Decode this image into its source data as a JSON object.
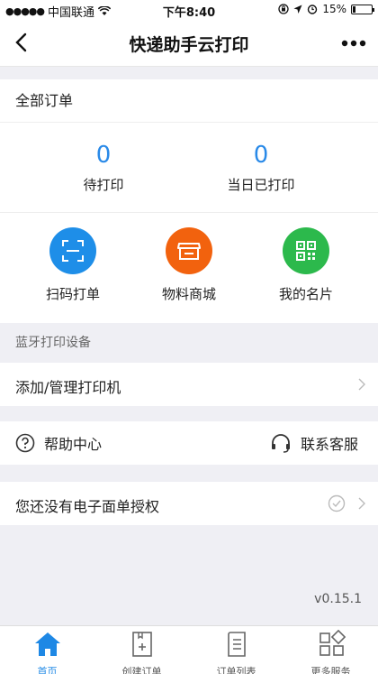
{
  "status_bar": {
    "carrier": "中国联通",
    "time": "下午8:40",
    "battery_percent": "15%",
    "battery_level": 0.15,
    "icons": [
      "signal-dots-icon",
      "wifi-icon",
      "screen-lock-icon",
      "location-icon",
      "alarm-icon",
      "battery-icon"
    ]
  },
  "nav": {
    "title": "快递助手云打印",
    "back_icon": "chevron-left-icon",
    "more_icon": "more-dots-icon"
  },
  "orders": {
    "heading": "全部订单",
    "stats": [
      {
        "value": "0",
        "label": "待打印"
      },
      {
        "value": "0",
        "label": "当日已打印"
      }
    ],
    "actions": [
      {
        "label": "扫码打单",
        "icon": "scan-icon",
        "color": "#1e8ee8"
      },
      {
        "label": "物料商城",
        "icon": "shop-icon",
        "color": "#f2620e"
      },
      {
        "label": "我的名片",
        "icon": "qr-code-icon",
        "color": "#2cb94c"
      }
    ]
  },
  "bluetooth": {
    "section_label": "蓝牙打印设备",
    "manage_printer": "添加/管理打印机"
  },
  "support": {
    "help_center": "帮助中心",
    "contact_service": "联系客服"
  },
  "waybill": {
    "label": "您还没有电子面单授权"
  },
  "version": "v0.15.1",
  "tabs": [
    {
      "label": "首页",
      "icon": "home-icon",
      "active": true
    },
    {
      "label": "创建订单",
      "icon": "create-order-icon",
      "active": false
    },
    {
      "label": "订单列表",
      "icon": "order-list-icon",
      "active": false
    },
    {
      "label": "更多服务",
      "icon": "more-services-icon",
      "active": false
    }
  ],
  "colors": {
    "accent_blue": "#2a8ae8",
    "tab_active": "#1e88e5",
    "background": "#efeff4"
  }
}
